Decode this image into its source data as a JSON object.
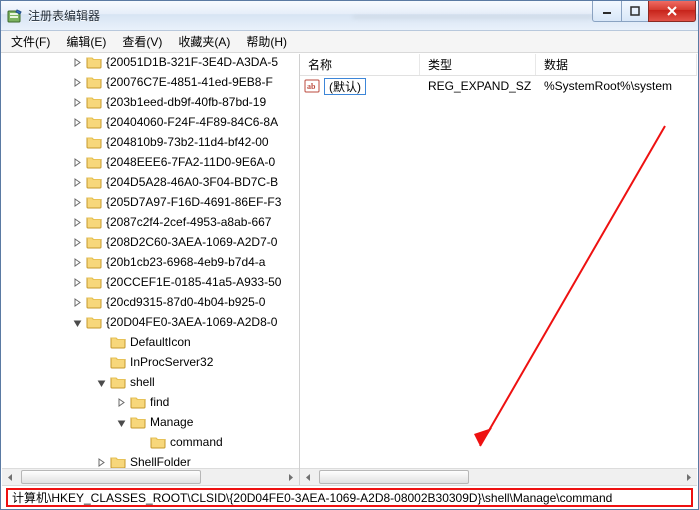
{
  "window": {
    "title": "注册表编辑器"
  },
  "menu": {
    "file": "文件(F)",
    "edit": "编辑(E)",
    "view": "查看(V)",
    "favorites": "收藏夹(A)",
    "help": "帮助(H)"
  },
  "tree": {
    "items": [
      {
        "indent": 68,
        "twisty": "closed",
        "label": "{20051D1B-321F-3E4D-A3DA-5"
      },
      {
        "indent": 68,
        "twisty": "closed",
        "label": "{20076C7E-4851-41ed-9EB8-F"
      },
      {
        "indent": 68,
        "twisty": "closed",
        "label": "{203b1eed-db9f-40fb-87bd-19"
      },
      {
        "indent": 68,
        "twisty": "closed",
        "label": "{20404060-F24F-4F89-84C6-8A"
      },
      {
        "indent": 68,
        "twisty": "none",
        "label": "{204810b9-73b2-11d4-bf42-00"
      },
      {
        "indent": 68,
        "twisty": "closed",
        "label": "{2048EEE6-7FA2-11D0-9E6A-0"
      },
      {
        "indent": 68,
        "twisty": "closed",
        "label": "{204D5A28-46A0-3F04-BD7C-B"
      },
      {
        "indent": 68,
        "twisty": "closed",
        "label": "{205D7A97-F16D-4691-86EF-F3"
      },
      {
        "indent": 68,
        "twisty": "closed",
        "label": "{2087c2f4-2cef-4953-a8ab-667"
      },
      {
        "indent": 68,
        "twisty": "closed",
        "label": "{208D2C60-3AEA-1069-A2D7-0"
      },
      {
        "indent": 68,
        "twisty": "closed",
        "label": "{20b1cb23-6968-4eb9-b7d4-a"
      },
      {
        "indent": 68,
        "twisty": "closed",
        "label": "{20CCEF1E-0185-41a5-A933-50"
      },
      {
        "indent": 68,
        "twisty": "closed",
        "label": "{20cd9315-87d0-4b04-b925-0"
      },
      {
        "indent": 68,
        "twisty": "open",
        "label": "{20D04FE0-3AEA-1069-A2D8-0"
      },
      {
        "indent": 92,
        "twisty": "none",
        "label": "DefaultIcon"
      },
      {
        "indent": 92,
        "twisty": "none",
        "label": "InProcServer32"
      },
      {
        "indent": 92,
        "twisty": "open",
        "label": "shell"
      },
      {
        "indent": 112,
        "twisty": "closed",
        "label": "find"
      },
      {
        "indent": 112,
        "twisty": "open",
        "label": "Manage"
      },
      {
        "indent": 132,
        "twisty": "none",
        "label": "command"
      },
      {
        "indent": 92,
        "twisty": "closed",
        "label": "ShellFolder"
      }
    ]
  },
  "list": {
    "columns": {
      "name": "名称",
      "type": "类型",
      "data": "数据"
    },
    "rows": [
      {
        "name": "(默认)",
        "type": "REG_EXPAND_SZ",
        "data": "%SystemRoot%\\system"
      }
    ]
  },
  "statusbar": {
    "path": "计算机\\HKEY_CLASSES_ROOT\\CLSID\\{20D04FE0-3AEA-1069-A2D8-08002B30309D}\\shell\\Manage\\command"
  }
}
